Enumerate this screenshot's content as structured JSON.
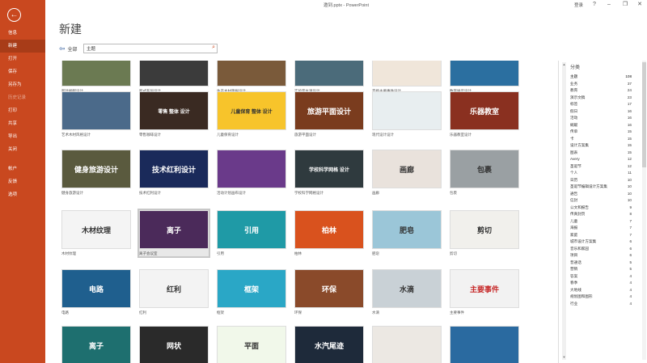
{
  "window": {
    "title": "邀到.pptx  -  PowerPoint",
    "login": "登录"
  },
  "sidebar": {
    "back": "←",
    "items": [
      {
        "label": "信息",
        "state": "normal"
      },
      {
        "label": "新建",
        "state": "active"
      },
      {
        "label": "打开",
        "state": "normal"
      },
      {
        "label": "保存",
        "state": "normal"
      },
      {
        "label": "另存为",
        "state": "normal"
      },
      {
        "label": "历史记录",
        "state": "disabled"
      },
      {
        "label": "打印",
        "state": "normal"
      },
      {
        "label": "共享",
        "state": "normal"
      },
      {
        "label": "导出",
        "state": "normal"
      },
      {
        "label": "关闭",
        "state": "normal"
      },
      {
        "label": "",
        "state": "sep"
      },
      {
        "label": "帐户",
        "state": "normal"
      },
      {
        "label": "反馈",
        "state": "normal"
      },
      {
        "label": "选项",
        "state": "normal"
      }
    ]
  },
  "header": {
    "title": "新建"
  },
  "nav": {
    "back_label": "全部",
    "search_value": "主题",
    "search_icon": "search-icon"
  },
  "gallery": {
    "tiles": [
      {
        "label": "新叶蜿蜒设计",
        "text": "",
        "bg": "#6b7a52"
      },
      {
        "label": "新式布局设计",
        "text": "",
        "bg": "#3b3b3b"
      },
      {
        "label": "生产木材简报设计",
        "text": "",
        "bg": "#7a5a3a"
      },
      {
        "label": "实验室水滴设计",
        "text": "",
        "bg": "#4b6b7a"
      },
      {
        "label": "音扬主要事件设计",
        "text": "",
        "bg": "#f0e6da"
      },
      {
        "label": "数字展示设计",
        "text": "",
        "bg": "#2b6fa0"
      },
      {
        "label": "艺术木材风格设计",
        "text": "",
        "bg": "#4b6a8a"
      },
      {
        "label": "零售咖啡设计",
        "text": "零售 整体 设计",
        "bg": "#3a2a22"
      },
      {
        "label": "儿童保育设计",
        "text": "儿童保育 整体 设计",
        "bg": "#f7c42b"
      },
      {
        "label": "旅游平面设计",
        "text": "旅游平面设计",
        "bg": "#7a3c1e"
      },
      {
        "label": "现代设计设计",
        "text": "",
        "bg": "#e8eef0"
      },
      {
        "label": "乐器教室设计",
        "text": "乐器教室",
        "bg": "#8a3020"
      },
      {
        "label": "健身旅游设计",
        "text": "健身旅游设计",
        "bg": "#5a5a3e"
      },
      {
        "label": "技术红利设计",
        "text": "技术红利设计",
        "bg": "#1a2a5a"
      },
      {
        "label": "活动计划画布设计",
        "text": "",
        "bg": "#6a3a8a"
      },
      {
        "label": "学校科学网格设计",
        "text": "学校科学网格 设计",
        "bg": "#2f3a3e"
      },
      {
        "label": "画廊",
        "text": "画廊",
        "bg": "#e9e2dc"
      },
      {
        "label": "包裹",
        "text": "包裹",
        "bg": "#9aa0a3"
      },
      {
        "label": "木材纹理",
        "text": "木材纹理",
        "bg": "#f4f4f4"
      },
      {
        "label": "离子会议室",
        "text": "离子",
        "bg": "#4b2a5a"
      },
      {
        "label": "引用",
        "text": "引用",
        "bg": "#1f9aa6"
      },
      {
        "label": "柏林",
        "text": "柏林",
        "bg": "#d9521e"
      },
      {
        "label": "肥皂",
        "text": "肥皂",
        "bg": "#9bc6d8"
      },
      {
        "label": "剪切",
        "text": "剪切",
        "bg": "#f1f0ec"
      },
      {
        "label": "电路",
        "text": "电路",
        "bg": "#1f5f8e"
      },
      {
        "label": "红利",
        "text": "红利",
        "bg": "#f3f3f3"
      },
      {
        "label": "框架",
        "text": "框架",
        "bg": "#2aa7c6"
      },
      {
        "label": "环保",
        "text": "环保",
        "bg": "#8a4a2a"
      },
      {
        "label": "水滴",
        "text": "水滴",
        "bg": "#c9d1d6"
      },
      {
        "label": "主要事件",
        "text": "主要事件",
        "bg": "#f2f2f2"
      },
      {
        "label": "",
        "text": "离子",
        "bg": "#1e6f6f"
      },
      {
        "label": "",
        "text": "网状",
        "bg": "#2a2a2a"
      },
      {
        "label": "",
        "text": "平面",
        "bg": "#f1f8ea"
      },
      {
        "label": "",
        "text": "水汽尾迹",
        "bg": "#1e2a3a"
      },
      {
        "label": "",
        "text": "",
        "bg": "#ece8e3"
      },
      {
        "label": "",
        "text": "",
        "bg": "#2a6aa0"
      }
    ]
  },
  "categories": {
    "title": "分类",
    "items": [
      {
        "name": "主题",
        "count": "108"
      },
      {
        "name": "业务",
        "count": "37"
      },
      {
        "name": "教育",
        "count": "24"
      },
      {
        "name": "演示文稿",
        "count": "23"
      },
      {
        "name": "标签",
        "count": "17"
      },
      {
        "name": "假日",
        "count": "16"
      },
      {
        "name": "活动",
        "count": "16"
      },
      {
        "name": "蜿蜒",
        "count": "16"
      },
      {
        "name": "传单",
        "count": "15"
      },
      {
        "name": "卡",
        "count": "15"
      },
      {
        "name": "设计方案集",
        "count": "15"
      },
      {
        "name": "图表",
        "count": "15"
      },
      {
        "name": "Avery",
        "count": "12"
      },
      {
        "name": "圣诞节",
        "count": "12"
      },
      {
        "name": "个人",
        "count": "11"
      },
      {
        "name": "日历",
        "count": "10"
      },
      {
        "name": "圣诞节编辑设计方案集",
        "count": "10"
      },
      {
        "name": "通告",
        "count": "10"
      },
      {
        "name": "信封",
        "count": "10"
      },
      {
        "name": "公文和报告",
        "count": "9"
      },
      {
        "name": "传真封页",
        "count": "8"
      },
      {
        "name": "儿童",
        "count": "7"
      },
      {
        "name": "海报",
        "count": "7"
      },
      {
        "name": "家庭",
        "count": "7"
      },
      {
        "name": "城市设计方案集",
        "count": "6"
      },
      {
        "name": "音乐和家园",
        "count": "6"
      },
      {
        "name": "项目",
        "count": "6"
      },
      {
        "name": "普通话",
        "count": "5"
      },
      {
        "name": "营销",
        "count": "5"
      },
      {
        "name": "答案",
        "count": "4"
      },
      {
        "name": "春季",
        "count": "4"
      },
      {
        "name": "大地线",
        "count": "4"
      },
      {
        "name": "规划图和图形",
        "count": "4"
      },
      {
        "name": "行业",
        "count": "4"
      }
    ]
  },
  "colors": {
    "accent": "#c9481f",
    "accent_dark": "#a83c18"
  }
}
